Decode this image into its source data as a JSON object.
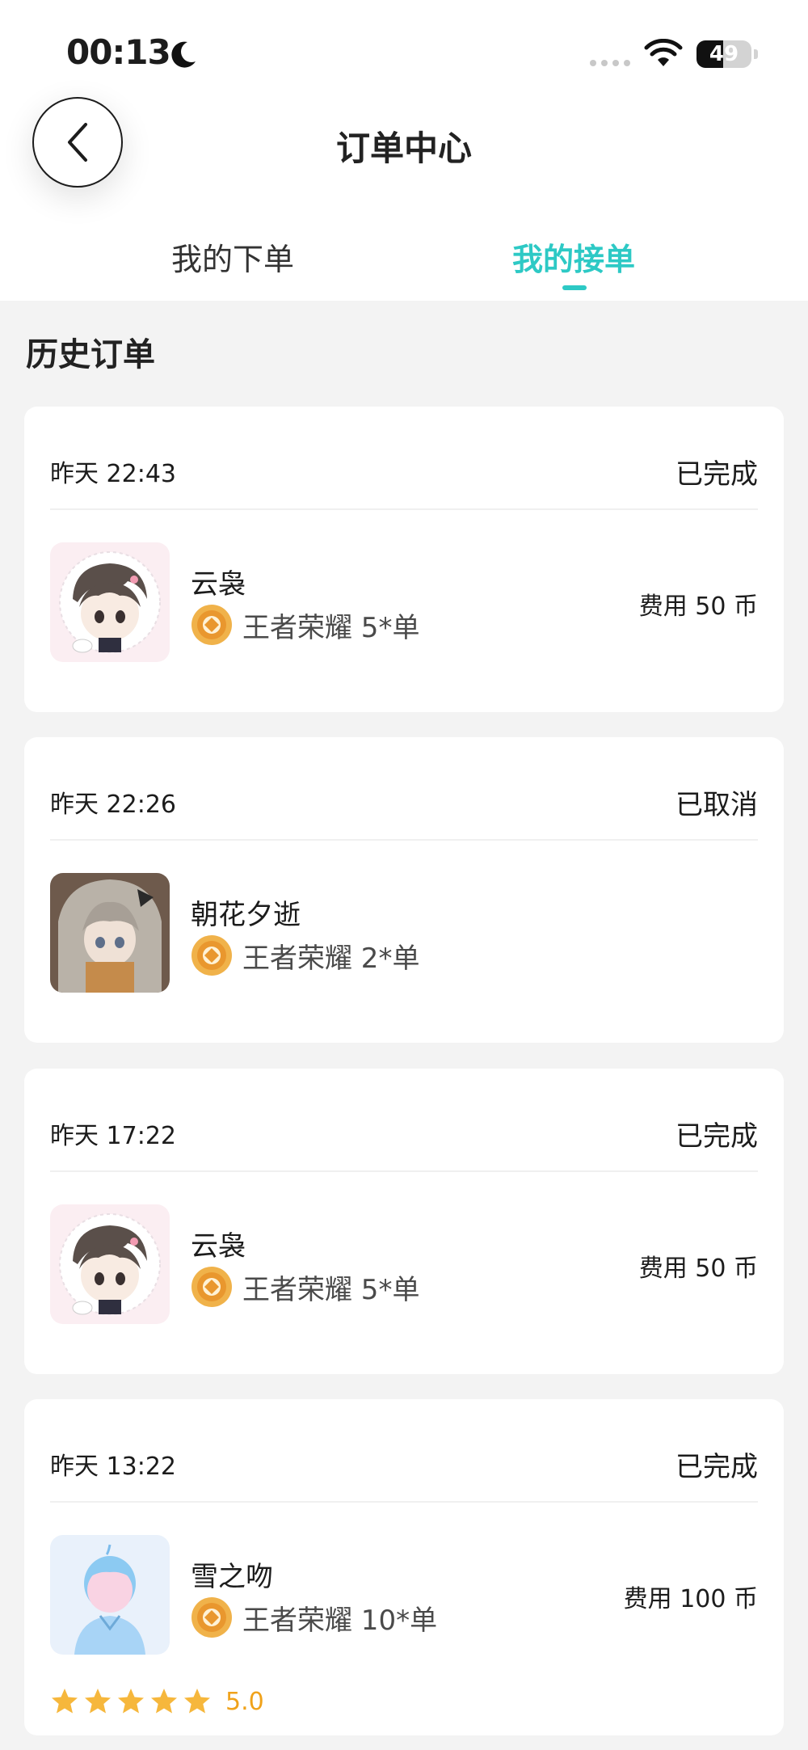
{
  "status_bar": {
    "time": "00:13",
    "battery": "49",
    "battery_level": 0.49
  },
  "header": {
    "title": "订单中心",
    "back_icon": "chevron-left-icon"
  },
  "tabs": [
    {
      "label": "我的下单",
      "active": false
    },
    {
      "label": "我的接单",
      "active": true
    }
  ],
  "accent_color": "#2dc9c5",
  "section": {
    "title": "历史订单"
  },
  "orders": [
    {
      "time": "昨天 22:43",
      "status": "已完成",
      "nickname": "云袅",
      "game": "王者荣耀 5*单",
      "price": "费用  50 币"
    },
    {
      "time": "昨天 22:26",
      "status": "已取消",
      "nickname": "朝花夕逝",
      "game": "王者荣耀 2*单"
    },
    {
      "time": "昨天 17:22",
      "status": "已完成",
      "nickname": "云袅",
      "game": "王者荣耀 5*单",
      "price": "费用  50 币"
    },
    {
      "time": "昨天 13:22",
      "status": "已完成",
      "nickname": "雪之吻",
      "game": "王者荣耀 10*单",
      "price": "费用  100 币",
      "rating": "5.0",
      "stars": 5
    }
  ]
}
